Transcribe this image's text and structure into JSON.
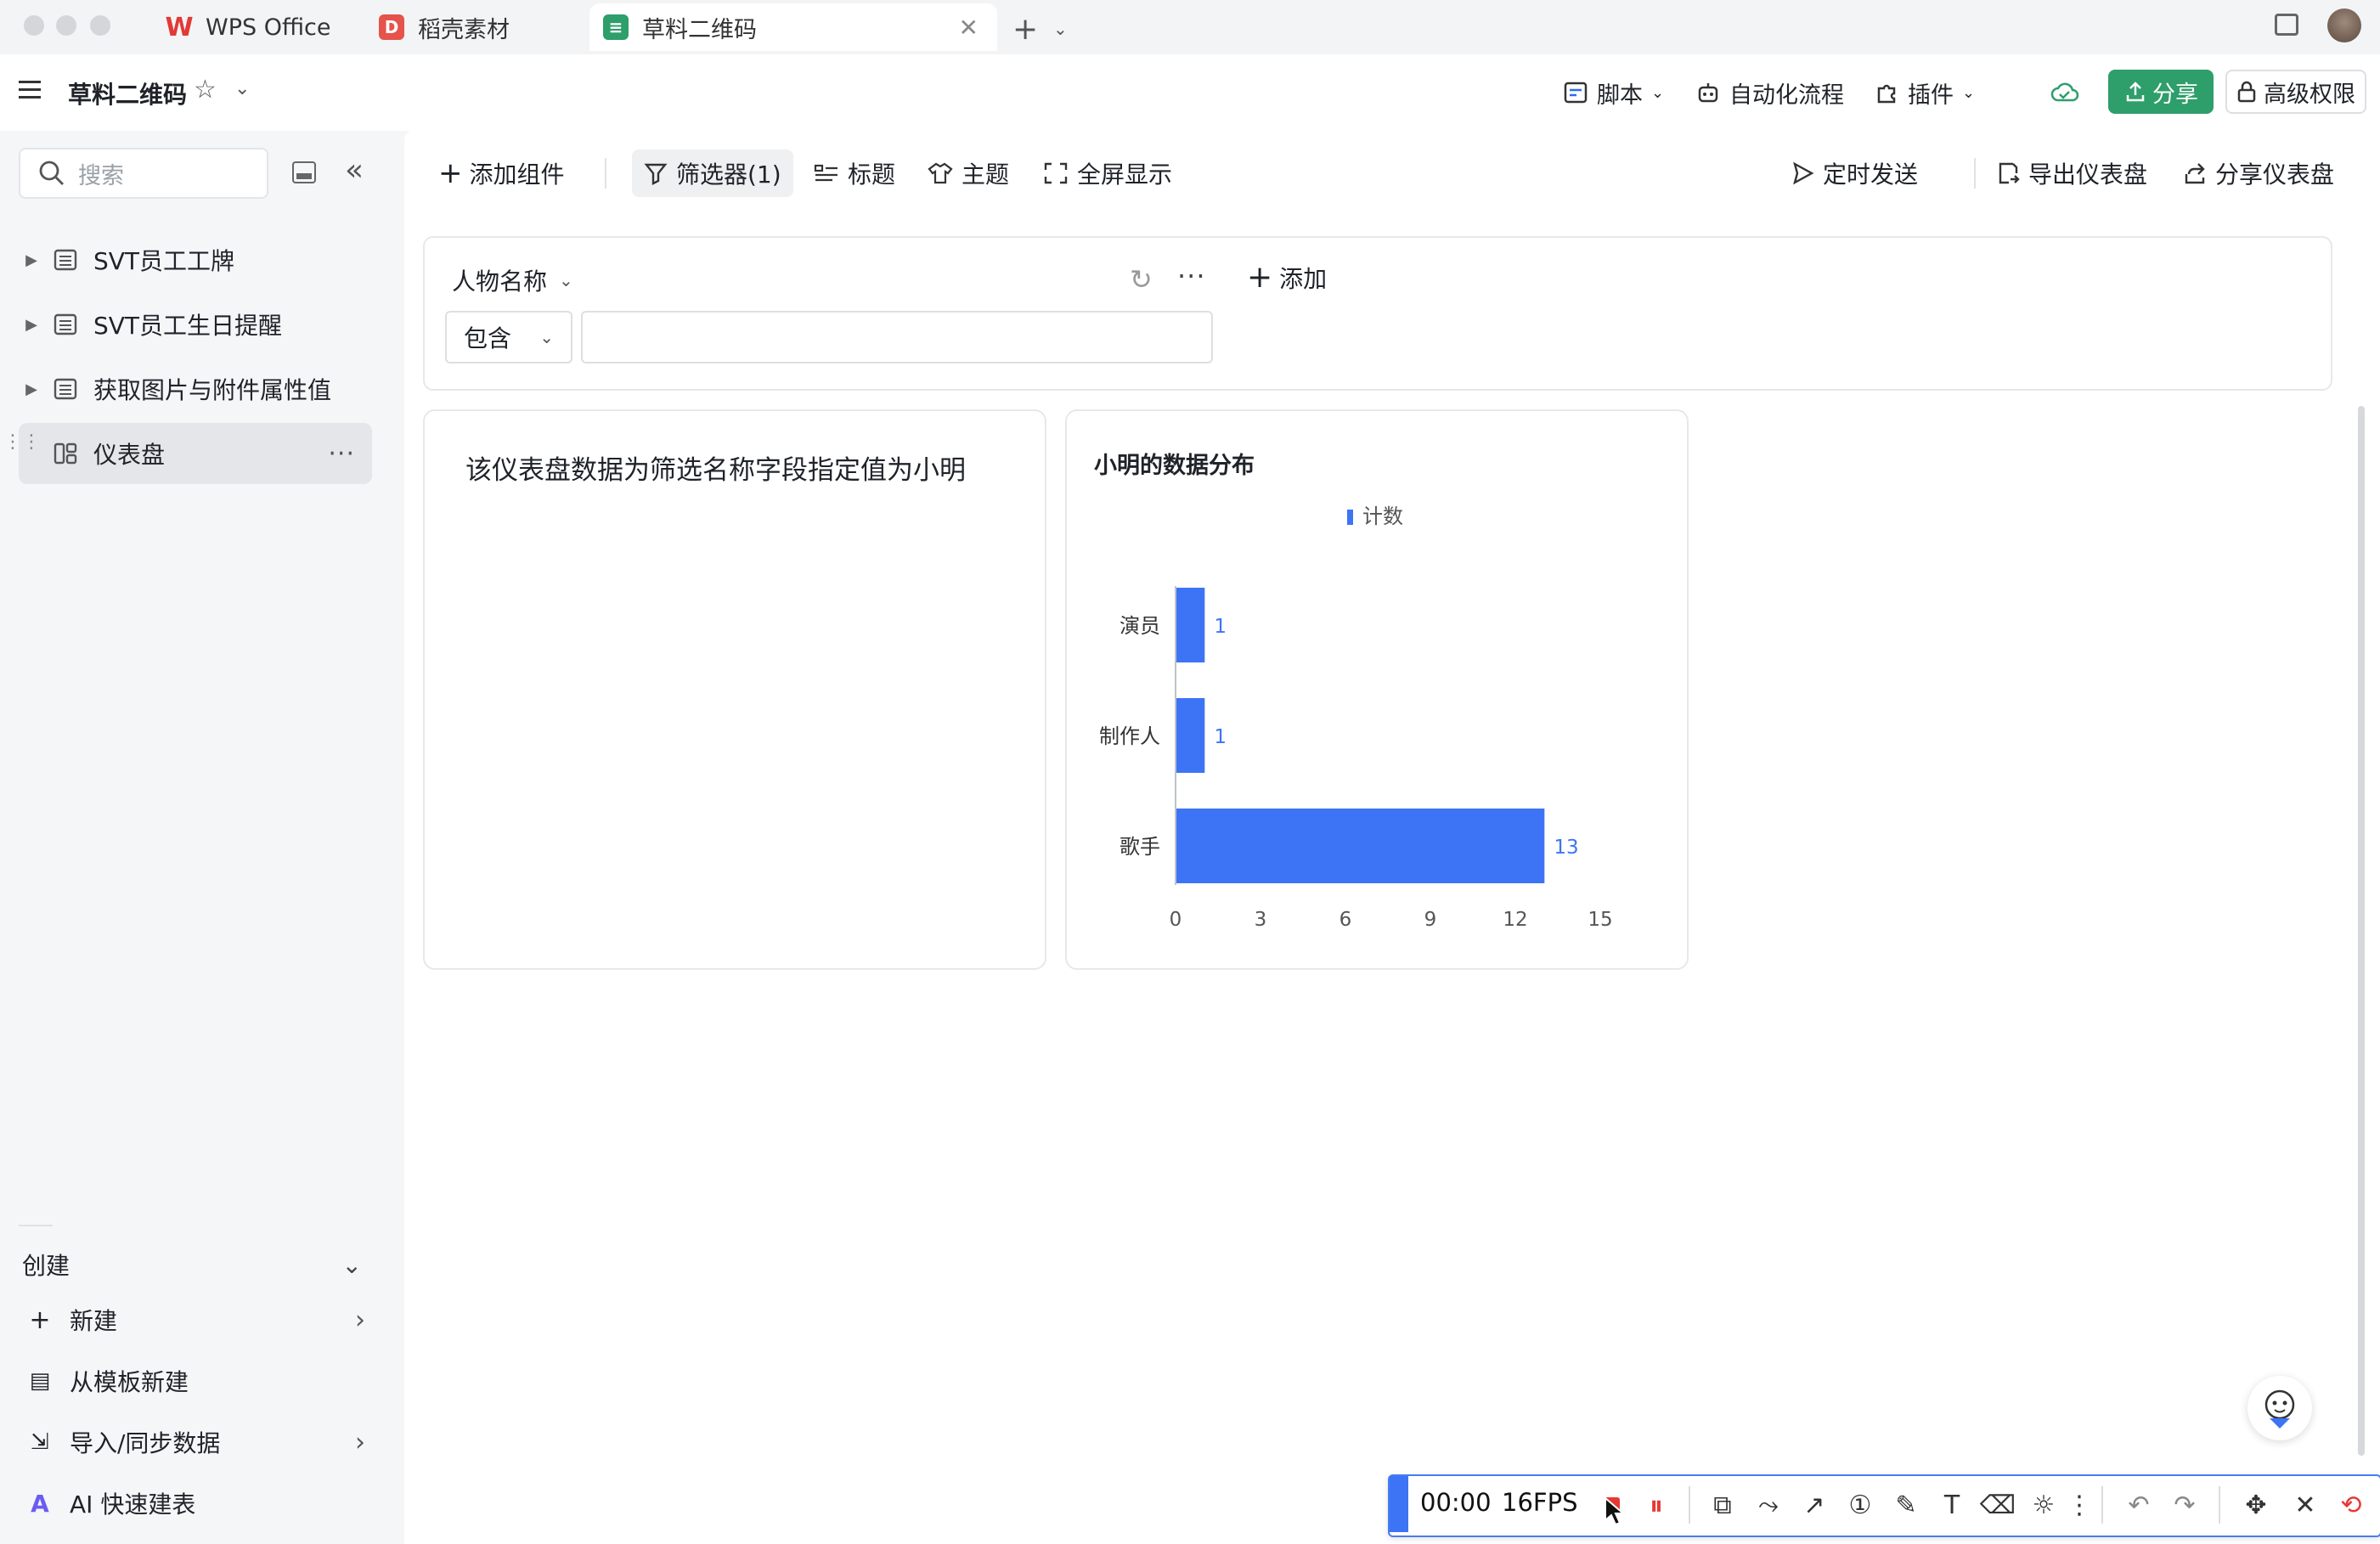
{
  "tabs": [
    {
      "label": "WPS Office",
      "icon": "wps-logo-icon"
    },
    {
      "label": "稻壳素材",
      "icon": "docer-icon"
    },
    {
      "label": "草料二维码",
      "icon": "sheet-icon",
      "active": true
    }
  ],
  "header": {
    "doc_title": "草料二维码",
    "buttons": {
      "script": "脚本",
      "automation": "自动化流程",
      "plugin": "插件",
      "share": "分享",
      "permission": "高级权限"
    },
    "share_color": "#2e9e6a"
  },
  "sidebar": {
    "search_placeholder": "搜索",
    "items": [
      {
        "label": "SVT员工工牌"
      },
      {
        "label": "SVT员工生日提醒"
      },
      {
        "label": "获取图片与附件属性值"
      },
      {
        "label": "仪表盘",
        "selected": true
      }
    ],
    "create_title": "创建",
    "create_items": [
      {
        "label": "新建"
      },
      {
        "label": "从模板新建"
      },
      {
        "label": "导入/同步数据"
      },
      {
        "label": "AI 快速建表"
      }
    ]
  },
  "toolbar": {
    "add_component": "添加组件",
    "filter": "筛选器(1)",
    "title": "标题",
    "theme": "主题",
    "fullscreen": "全屏显示",
    "schedule": "定时发送",
    "export": "导出仪表盘",
    "share_dashboard": "分享仪表盘"
  },
  "filter": {
    "field": "人物名称",
    "operator": "包含",
    "value": "",
    "add": "添加"
  },
  "text_card": {
    "text": "该仪表盘数据为筛选名称字段指定值为小明"
  },
  "chart_card": {
    "title": "小明的数据分布"
  },
  "chart_data": {
    "type": "bar",
    "orientation": "horizontal",
    "title": "小明的数据分布",
    "categories": [
      "演员",
      "制作人",
      "歌手"
    ],
    "series": [
      {
        "name": "计数",
        "values": [
          1,
          1,
          13
        ]
      }
    ],
    "x_ticks": [
      0,
      3,
      6,
      9,
      12,
      15
    ],
    "xlim": [
      0,
      15
    ],
    "legend": "top",
    "grid": false,
    "bar_color": "#3d74f5"
  },
  "recorder": {
    "time": "00:00",
    "fps": "16FPS"
  }
}
